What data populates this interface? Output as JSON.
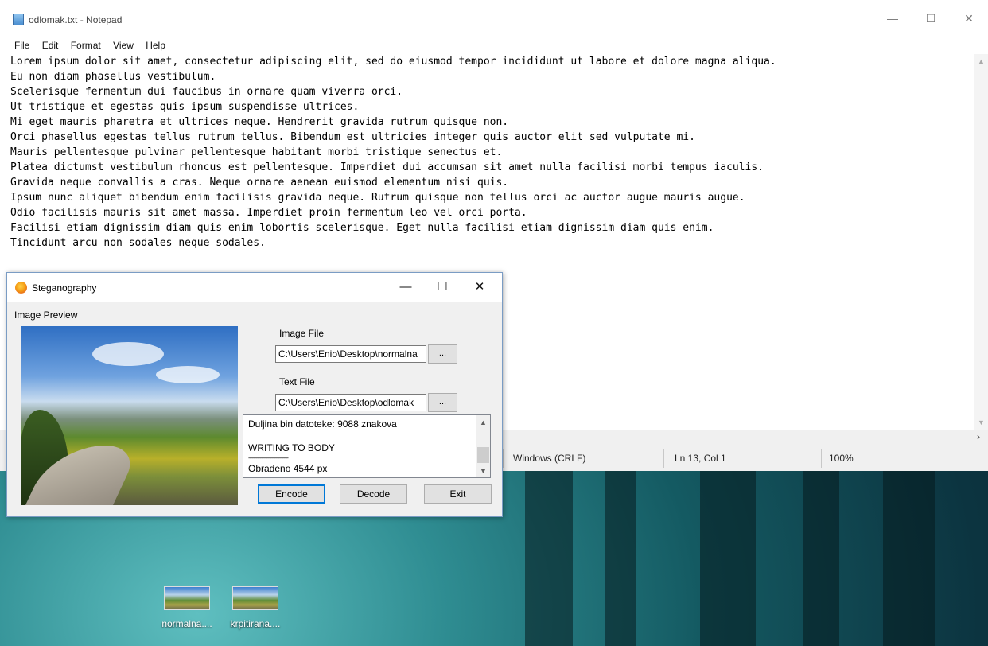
{
  "notepad": {
    "title": "odlomak.txt - Notepad",
    "controls": {
      "minimize": "—",
      "maximize": "☐",
      "close": "✕"
    },
    "menu": [
      "File",
      "Edit",
      "Format",
      "View",
      "Help"
    ],
    "lines": [
      "Lorem ipsum dolor sit amet, consectetur adipiscing elit, sed do eiusmod tempor incididunt ut labore et dolore magna aliqua.",
      "Eu non diam phasellus vestibulum.",
      "Scelerisque fermentum dui faucibus in ornare quam viverra orci.",
      "Ut tristique et egestas quis ipsum suspendisse ultrices.",
      "Mi eget mauris pharetra et ultrices neque. Hendrerit gravida rutrum quisque non.",
      "Orci phasellus egestas tellus rutrum tellus. Bibendum est ultricies integer quis auctor elit sed vulputate mi.",
      "Mauris pellentesque pulvinar pellentesque habitant morbi tristique senectus et.",
      "Platea dictumst vestibulum rhoncus est pellentesque. Imperdiet dui accumsan sit amet nulla facilisi morbi tempus iaculis.",
      "Gravida neque convallis a cras. Neque ornare aenean euismod elementum nisi quis.",
      "Ipsum nunc aliquet bibendum enim facilisis gravida neque. Rutrum quisque non tellus orci ac auctor augue mauris augue.",
      "Odio facilisis mauris sit amet massa. Imperdiet proin fermentum leo vel orci porta.",
      "Facilisi etiam dignissim diam quis enim lobortis scelerisque. Eget nulla facilisi etiam dignissim diam quis enim.",
      "Tincidunt arcu non sodales neque sodales."
    ],
    "status": {
      "line_ending": "Windows (CRLF)",
      "position": "Ln 13, Col 1",
      "zoom": "100%"
    }
  },
  "steg": {
    "title": "Steganography",
    "controls": {
      "minimize": "—",
      "maximize": "☐",
      "close": "✕"
    },
    "preview_label": "Image Preview",
    "image_file_label": "Image File",
    "image_file_value": "C:\\Users\\Enio\\Desktop\\normalna",
    "text_file_label": "Text File",
    "text_file_value": "C:\\Users\\Enio\\Desktop\\odlomak",
    "browse_label": "...",
    "log_lines": [
      "Duljina bin datoteke: 9088 znakova",
      "",
      "WRITING TO BODY",
      "------------------------------",
      "Obradeno 4544 px"
    ],
    "buttons": {
      "encode": "Encode",
      "decode": "Decode",
      "exit": "Exit"
    }
  },
  "desktop": {
    "icons": [
      {
        "label": "normalna...."
      },
      {
        "label": "krpitirana...."
      }
    ]
  }
}
